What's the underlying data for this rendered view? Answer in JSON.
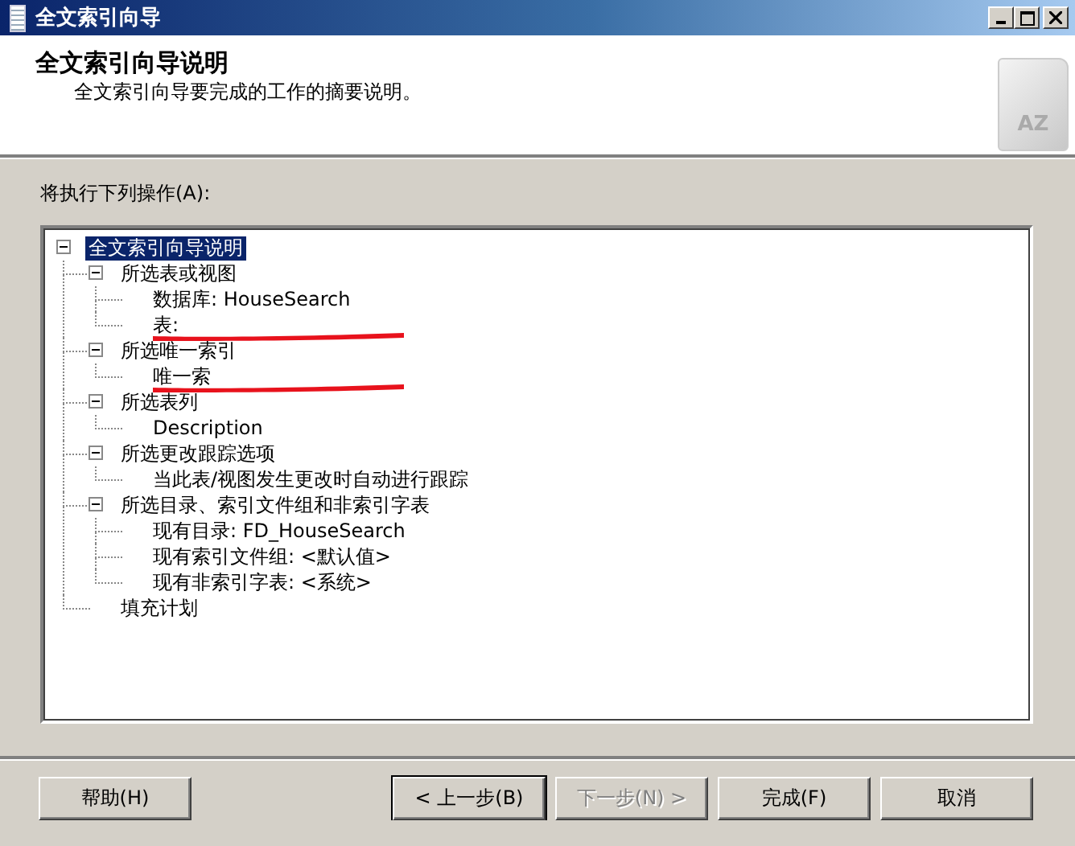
{
  "window": {
    "title": "全文索引向导"
  },
  "header": {
    "title": "全文索引向导说明",
    "subtitle": "全文索引向导要完成的工作的摘要说明。",
    "icon_text": "AZ"
  },
  "actions_label": "将执行下列操作(A):",
  "tree": [
    {
      "label": "全文索引向导说明",
      "selected": true,
      "expanded": true,
      "children": [
        {
          "label": "所选表或视图",
          "selected": false,
          "expanded": true,
          "children": [
            {
              "label": "数据库: HouseSearch",
              "selected": false,
              "redacted": false
            },
            {
              "label": "表:",
              "selected": false,
              "redacted": true
            }
          ]
        },
        {
          "label": "所选唯一索引",
          "selected": false,
          "expanded": true,
          "children": [
            {
              "label": "唯一索",
              "selected": false,
              "redacted": true
            }
          ]
        },
        {
          "label": "所选表列",
          "selected": false,
          "expanded": true,
          "children": [
            {
              "label": "Description",
              "selected": false,
              "redacted": false
            }
          ]
        },
        {
          "label": "所选更改跟踪选项",
          "selected": false,
          "expanded": true,
          "children": [
            {
              "label": "当此表/视图发生更改时自动进行跟踪",
              "selected": false,
              "redacted": false
            }
          ]
        },
        {
          "label": "所选目录、索引文件组和非索引字表",
          "selected": false,
          "expanded": true,
          "children": [
            {
              "label": "现有目录: FD_HouseSearch",
              "selected": false,
              "redacted": false
            },
            {
              "label": "现有索引文件组: <默认值>",
              "selected": false,
              "redacted": false
            },
            {
              "label": "现有非索引字表: <系统>",
              "selected": false,
              "redacted": false
            }
          ]
        },
        {
          "label": "填充计划",
          "selected": false,
          "redacted": false
        }
      ]
    }
  ],
  "buttons": [
    {
      "label": "帮助(H)",
      "disabled": false,
      "default": false
    },
    {
      "label": "< 上一步(B)",
      "disabled": false,
      "default": true
    },
    {
      "label": "下一步(N) >",
      "disabled": true,
      "default": false
    },
    {
      "label": "完成(F)",
      "disabled": false,
      "default": false
    },
    {
      "label": "取消",
      "disabled": false,
      "default": false
    }
  ]
}
